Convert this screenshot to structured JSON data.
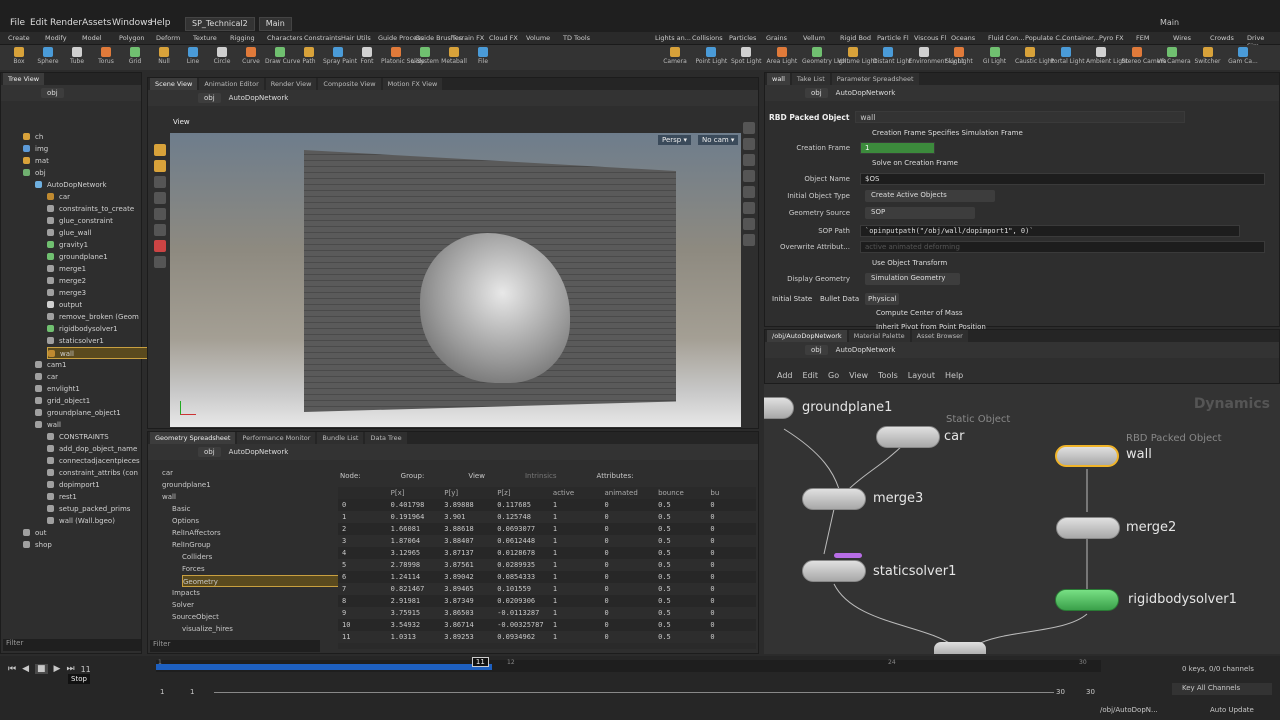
{
  "menubar": {
    "items": [
      "File",
      "Edit",
      "Render",
      "Assets",
      "Windows",
      "Help"
    ],
    "desktop": "SP_Technical2",
    "main": "Main",
    "right_main": "Main"
  },
  "shelf": {
    "left_tabs": [
      "Create",
      "Modify",
      "Model",
      "Polygon",
      "Deform",
      "Texture",
      "Rigging",
      "Characters",
      "Constraints",
      "Hair Utils",
      "Guide Process",
      "Guide Brushes",
      "Terrain FX",
      "Cloud FX",
      "Volume",
      "TD Tools"
    ],
    "right_tabs": [
      "Lights an...",
      "Collisions",
      "Particles",
      "Grains",
      "Vellum",
      "Rigid Bod",
      "Particle Fl",
      "Viscous Fl",
      "Oceans",
      "Fluid Con...",
      "Populate C...",
      "Container...",
      "Pyro FX",
      "FEM",
      "Wires",
      "Crowds",
      "Drive Sim..."
    ],
    "left_tools": [
      "Box",
      "Sphere",
      "Tube",
      "Torus",
      "Grid",
      "Null",
      "Line",
      "Circle",
      "Curve",
      "Draw Curve",
      "Path",
      "Spray Paint",
      "Font",
      "Platonic Solids",
      "L-System",
      "Metaball",
      "File"
    ],
    "right_tools": [
      "Camera",
      "Point Light",
      "Spot Light",
      "Area Light",
      "Geometry Light",
      "Volume Light",
      "Distant Light",
      "Environment Light",
      "Sky Light",
      "GI Light",
      "Caustic Light",
      "Portal Light",
      "Ambient Light",
      "Stereo Camera",
      "VR Camera",
      "Switcher",
      "Gam Ca..."
    ]
  },
  "tree": {
    "tab": "Tree View",
    "path": "obj",
    "filter": "Filter",
    "items": [
      "ch",
      "img",
      "mat",
      "obj",
      "AutoDopNetwork",
      "car",
      "constraints_to_create",
      "glue_constraint",
      "glue_wall",
      "gravity1",
      "groundplane1",
      "merge1",
      "merge2",
      "merge3",
      "output",
      "remove_broken (Geom",
      "rigidbodysolver1",
      "staticsolver1",
      "wall",
      "cam1",
      "car",
      "envlight1",
      "grid_object1",
      "groundplane_object1",
      "wall",
      "CONSTRAINTS",
      "add_dop_object_name",
      "connectadjacentpieces",
      "constraint_attribs (con",
      "dopimport1",
      "rest1",
      "setup_packed_prims",
      "wall (Wall.bgeo)",
      "out",
      "shop"
    ]
  },
  "scene": {
    "tabs": [
      "Scene View",
      "Animation Editor",
      "Render View",
      "Composite View",
      "Motion FX View"
    ],
    "path_root": "obj",
    "path_node": "AutoDopNetwork",
    "view_label": "View",
    "persp": "Persp ▾",
    "cam": "No cam ▾"
  },
  "spreadsheet": {
    "tabs": [
      "Geometry Spreadsheet",
      "Performance Monitor",
      "Bundle List",
      "Data Tree"
    ],
    "path_root": "obj",
    "path_node": "AutoDopNetwork",
    "tree": [
      "car",
      "groundplane1",
      "wall",
      "Basic",
      "Options",
      "RelInAffectors",
      "RelInGroup",
      "Colliders",
      "Forces",
      "Geometry",
      "Impacts",
      "Solver",
      "SourceObject",
      "visualize_hires"
    ],
    "filter": "Filter",
    "node_label": "Node:",
    "group_label": "Group:",
    "view_label": "View",
    "intrinsics": "Intrinsics",
    "attributes": "Attributes:",
    "columns": [
      "",
      "P[x]",
      "P[y]",
      "P[z]",
      "active",
      "animated",
      "bounce",
      "bu"
    ],
    "rows": [
      [
        "0",
        "0.401798",
        "3.89888",
        "0.117685",
        "1",
        "0",
        "0.5",
        "0"
      ],
      [
        "1",
        "0.191964",
        "3.901",
        "0.125748",
        "1",
        "0",
        "0.5",
        "0"
      ],
      [
        "2",
        "1.66081",
        "3.88618",
        "0.0693077",
        "1",
        "0",
        "0.5",
        "0"
      ],
      [
        "3",
        "1.87064",
        "3.88407",
        "0.0612448",
        "1",
        "0",
        "0.5",
        "0"
      ],
      [
        "4",
        "3.12965",
        "3.87137",
        "0.0128678",
        "1",
        "0",
        "0.5",
        "0"
      ],
      [
        "5",
        "2.78998",
        "3.87561",
        "0.0289935",
        "1",
        "0",
        "0.5",
        "0"
      ],
      [
        "6",
        "1.24114",
        "3.89042",
        "0.0854333",
        "1",
        "0",
        "0.5",
        "0"
      ],
      [
        "7",
        "0.821467",
        "3.89465",
        "0.101559",
        "1",
        "0",
        "0.5",
        "0"
      ],
      [
        "8",
        "2.91981",
        "3.87349",
        "0.0209306",
        "1",
        "0",
        "0.5",
        "0"
      ],
      [
        "9",
        "3.75915",
        "3.86503",
        "-0.0113287",
        "1",
        "0",
        "0.5",
        "0"
      ],
      [
        "10",
        "3.54932",
        "3.86714",
        "-0.00325787",
        "1",
        "0",
        "0.5",
        "0"
      ],
      [
        "11",
        "1.0313",
        "3.89253",
        "0.0934962",
        "1",
        "0",
        "0.5",
        "0"
      ]
    ]
  },
  "params": {
    "tabs": [
      "wall",
      "Take List",
      "Parameter Spreadsheet"
    ],
    "path_root": "obj",
    "path_node": "AutoDopNetwork",
    "node_type": "RBD Packed Object",
    "node_name": "wall",
    "creation_frame_specifies": "Creation Frame Specifies Simulation Frame",
    "creation_frame_label": "Creation Frame",
    "creation_frame_value": "1",
    "solve_on_creation": "Solve on Creation Frame",
    "object_name_label": "Object Name",
    "object_name_value": "$OS",
    "initial_type_label": "Initial Object Type",
    "initial_type_value": "Create Active Objects",
    "geo_source_label": "Geometry Source",
    "geo_source_value": "SOP",
    "sop_path_label": "SOP Path",
    "sop_path_value": "`opinputpath(\"/obj/wall/dopimport1\", 0)`",
    "overwrite_label": "Overwrite Attribut...",
    "overwrite_value": "active animated deforming",
    "use_transform": "Use Object Transform",
    "display_geo_label": "Display Geometry",
    "display_geo_value": "Simulation Geometry",
    "subtabs": [
      "Initial State",
      "Bullet Data",
      "Physical"
    ],
    "compute_com": "Compute Center of Mass",
    "inherit": "Inherit Pivot from Point Position"
  },
  "network": {
    "tabs": [
      "/obj/AutoDopNetwork",
      "Material Palette",
      "Asset Browser"
    ],
    "path_root": "obj",
    "path_node": "AutoDopNetwork",
    "menu": [
      "Add",
      "Edit",
      "Go",
      "View",
      "Tools",
      "Layout",
      "Help"
    ],
    "context": "Dynamics",
    "nodes": {
      "groundplane1": "groundplane1",
      "car_type": "Static Object",
      "car": "car",
      "wall_type": "RBD Packed Object",
      "wall": "wall",
      "merge3": "merge3",
      "merge2": "merge2",
      "staticsolver1": "staticsolver1",
      "rigidbodysolver1": "rigidbodysolver1"
    }
  },
  "timeline": {
    "frame": "11",
    "current": "11",
    "ticks": [
      "1",
      "12",
      "24",
      "30"
    ],
    "start": "1",
    "start2": "1",
    "end": "30",
    "end2": "30",
    "stop_tooltip": "Stop",
    "keys": "0 keys, 0/0 channels",
    "all_channels": "Key All Channels",
    "status_path": "/obj/AutoDopN...",
    "auto_update": "Auto Update"
  },
  "colors": {
    "accent": "#f0b429",
    "selected_row": "#5a4a1e",
    "timeline_blue": "#1d5fbf",
    "node_green": "#5cc46a",
    "node_purple": "#b86de6"
  }
}
